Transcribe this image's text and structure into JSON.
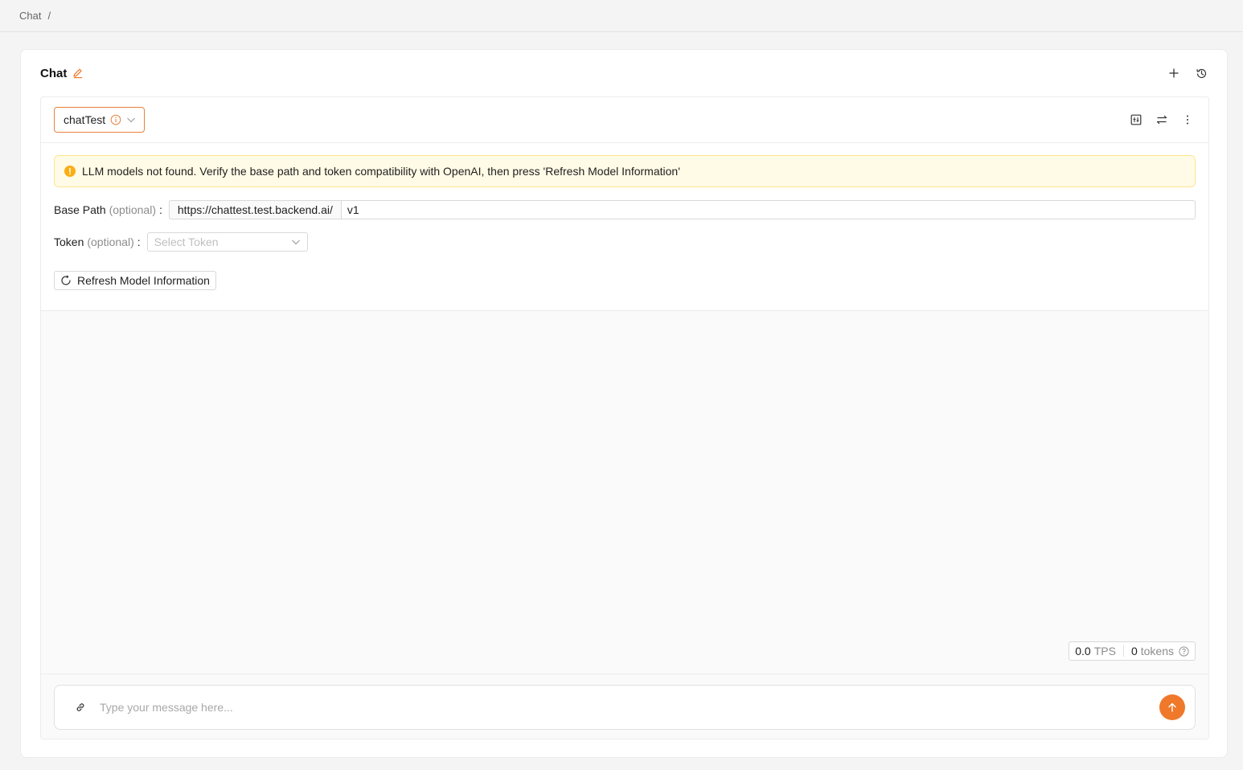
{
  "breadcrumb": {
    "item": "Chat",
    "separator": "/"
  },
  "card": {
    "title": "Chat"
  },
  "model_select": {
    "value": "chatTest"
  },
  "alert": {
    "message": "LLM models not found. Verify the base path and token compatibility with OpenAI, then press 'Refresh Model Information'"
  },
  "base_path": {
    "label": "Base Path",
    "optional": "(optional)",
    "colon": ":",
    "prefix": "https://chattest.test.backend.ai/",
    "value": "v1"
  },
  "token": {
    "label": "Token",
    "optional": "(optional)",
    "colon": ":",
    "placeholder": "Select Token"
  },
  "refresh_button": {
    "label": "Refresh Model Information"
  },
  "stats": {
    "tps_value": "0.0",
    "tps_unit": "TPS",
    "tokens_value": "0",
    "tokens_unit": "tokens"
  },
  "message_input": {
    "placeholder": "Type your message here..."
  },
  "colors": {
    "accent": "#f0782a",
    "warning": "#faad14",
    "warning_bg": "#fffbe6"
  },
  "icons": [
    "edit-icon",
    "plus-icon",
    "history-icon",
    "info-icon",
    "chevron-down-icon",
    "compare-icon",
    "swap-icon",
    "more-icon",
    "warning-icon",
    "refresh-icon",
    "help-icon",
    "link-icon",
    "arrow-up-icon"
  ]
}
